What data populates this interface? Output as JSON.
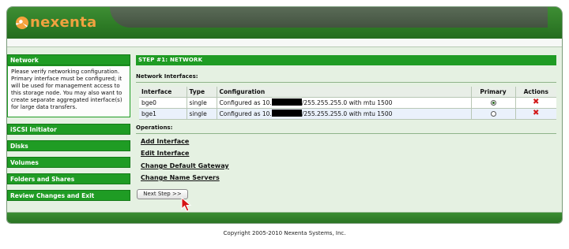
{
  "brand": {
    "name": "nexenta",
    "logo_icon": "nexenta-swirl-logo"
  },
  "sidebar": {
    "items": [
      {
        "label": "Network",
        "active": true
      },
      {
        "label": "iSCSI Initiator"
      },
      {
        "label": "Disks"
      },
      {
        "label": "Volumes"
      },
      {
        "label": "Folders and Shares"
      },
      {
        "label": "Review Changes and Exit"
      }
    ],
    "description": "Please verify networking configuration. Primary interface must be configured; it will be used for management access to this storage node. You may also want to create separate aggregated interface(s) for large data transfers."
  },
  "main": {
    "step_title": "STEP #1: NETWORK",
    "interfaces_label": "Network Interfaces:",
    "table": {
      "headers": [
        "Interface",
        "Type",
        "Configuration",
        "Primary",
        "Actions"
      ],
      "rows": [
        {
          "interface": "bge0",
          "type": "single",
          "config_prefix": "Configured as 10.",
          "config_suffix": "/255.255.255.0 with mtu 1500",
          "primary": true
        },
        {
          "interface": "bge1",
          "type": "single",
          "config_prefix": "Configured as 10.",
          "config_suffix": "/255.255.255.0 with mtu 1500",
          "primary": false
        }
      ]
    },
    "operations_label": "Operations:",
    "operations": [
      "Add Interface",
      "Edit Interface",
      "Change Default Gateway",
      "Change Name Servers"
    ],
    "next_button": "Next Step >>"
  },
  "footer": {
    "copyright": "Copyright 2005-2010 Nexenta Systems, Inc."
  },
  "colors": {
    "header_green": "#2d7a25",
    "nav_green": "#1f9c24",
    "panel_bg": "#e5f1e2",
    "logo_orange": "#f0a240",
    "delete_red": "#d21a1a"
  },
  "icons": {
    "primary": "radio-icon",
    "delete": "delete-x-icon",
    "pointer": "mouse-cursor-icon"
  }
}
